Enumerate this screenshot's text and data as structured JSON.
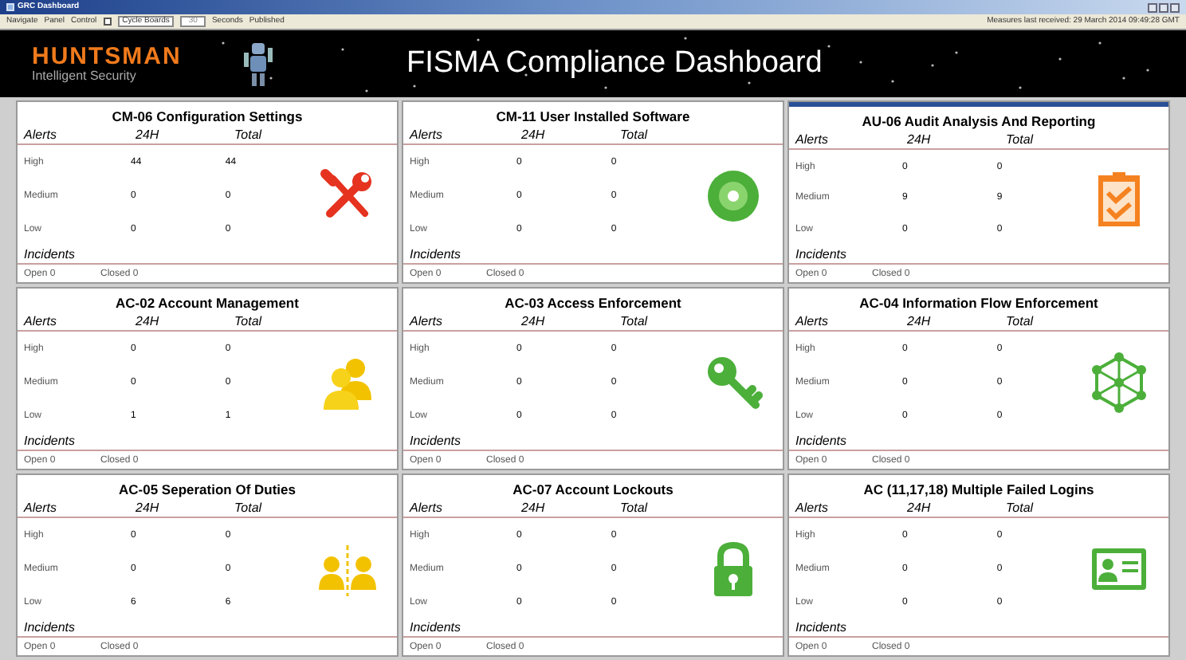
{
  "window": {
    "title": "GRC Dashboard"
  },
  "toolbar": {
    "items": [
      "Navigate",
      "Panel",
      "Control"
    ],
    "cycle": {
      "label": "Cycle Boards",
      "checked": false
    },
    "seconds_value": "30",
    "seconds_label": "Seconds",
    "published": "Published",
    "status": "Measures last received: 29 March 2014 09:49:28 GMT"
  },
  "header": {
    "brand": "HUNTSMAN",
    "tagline": "Intelligent Security",
    "title": "FISMA Compliance Dashboard"
  },
  "cards": [
    {
      "title": "CM-06 Configuration Settings",
      "selected": false,
      "columns": [
        "Alerts",
        "24H",
        "Total"
      ],
      "rows": [
        {
          "label": "High",
          "h24": "44",
          "total": "44"
        },
        {
          "label": "Medium",
          "h24": "0",
          "total": "0"
        },
        {
          "label": "Low",
          "h24": "0",
          "total": "0"
        }
      ],
      "incidents": "Incidents",
      "open": "Open 0",
      "closed": "Closed 0"
    },
    {
      "title": "CM-11 User Installed Software",
      "selected": false,
      "columns": [
        "Alerts",
        "24H",
        "Total"
      ],
      "rows": [
        {
          "label": "High",
          "h24": "0",
          "total": "0"
        },
        {
          "label": "Medium",
          "h24": "0",
          "total": "0"
        },
        {
          "label": "Low",
          "h24": "0",
          "total": "0"
        }
      ],
      "incidents": "Incidents",
      "open": "Open 0",
      "closed": "Closed 0"
    },
    {
      "title": "AU-06 Audit Analysis And Reporting",
      "selected": true,
      "columns": [
        "Alerts",
        "24H",
        "Total"
      ],
      "rows": [
        {
          "label": "High",
          "h24": "0",
          "total": "0"
        },
        {
          "label": "Medium",
          "h24": "9",
          "total": "9"
        },
        {
          "label": "Low",
          "h24": "0",
          "total": "0"
        }
      ],
      "incidents": "Incidents",
      "open": "Open 0",
      "closed": "Closed 0"
    },
    {
      "title": "AC-02 Account Management",
      "selected": false,
      "columns": [
        "Alerts",
        "24H",
        "Total"
      ],
      "rows": [
        {
          "label": "High",
          "h24": "0",
          "total": "0"
        },
        {
          "label": "Medium",
          "h24": "0",
          "total": "0"
        },
        {
          "label": "Low",
          "h24": "1",
          "total": "1"
        }
      ],
      "incidents": "Incidents",
      "open": "Open 0",
      "closed": "Closed 0"
    },
    {
      "title": "AC-03 Access Enforcement",
      "selected": false,
      "columns": [
        "Alerts",
        "24H",
        "Total"
      ],
      "rows": [
        {
          "label": "High",
          "h24": "0",
          "total": "0"
        },
        {
          "label": "Medium",
          "h24": "0",
          "total": "0"
        },
        {
          "label": "Low",
          "h24": "0",
          "total": "0"
        }
      ],
      "incidents": "Incidents",
      "open": "Open 0",
      "closed": "Closed 0"
    },
    {
      "title": "AC-04 Information Flow Enforcement",
      "selected": false,
      "columns": [
        "Alerts",
        "24H",
        "Total"
      ],
      "rows": [
        {
          "label": "High",
          "h24": "0",
          "total": "0"
        },
        {
          "label": "Medium",
          "h24": "0",
          "total": "0"
        },
        {
          "label": "Low",
          "h24": "0",
          "total": "0"
        }
      ],
      "incidents": "Incidents",
      "open": "Open 0",
      "closed": "Closed 0"
    },
    {
      "title": "AC-05 Seperation Of Duties",
      "selected": false,
      "columns": [
        "Alerts",
        "24H",
        "Total"
      ],
      "rows": [
        {
          "label": "High",
          "h24": "0",
          "total": "0"
        },
        {
          "label": "Medium",
          "h24": "0",
          "total": "0"
        },
        {
          "label": "Low",
          "h24": "6",
          "total": "6"
        }
      ],
      "incidents": "Incidents",
      "open": "Open 0",
      "closed": "Closed 0"
    },
    {
      "title": "AC-07 Account Lockouts",
      "selected": false,
      "columns": [
        "Alerts",
        "24H",
        "Total"
      ],
      "rows": [
        {
          "label": "High",
          "h24": "0",
          "total": "0"
        },
        {
          "label": "Medium",
          "h24": "0",
          "total": "0"
        },
        {
          "label": "Low",
          "h24": "0",
          "total": "0"
        }
      ],
      "incidents": "Incidents",
      "open": "Open 0",
      "closed": "Closed 0"
    },
    {
      "title": "AC (11,17,18) Multiple Failed Logins",
      "selected": false,
      "columns": [
        "Alerts",
        "24H",
        "Total"
      ],
      "rows": [
        {
          "label": "High",
          "h24": "0",
          "total": "0"
        },
        {
          "label": "Medium",
          "h24": "0",
          "total": "0"
        },
        {
          "label": "Low",
          "h24": "0",
          "total": "0"
        }
      ],
      "incidents": "Incidents",
      "open": "Open 0",
      "closed": "Closed 0"
    }
  ]
}
